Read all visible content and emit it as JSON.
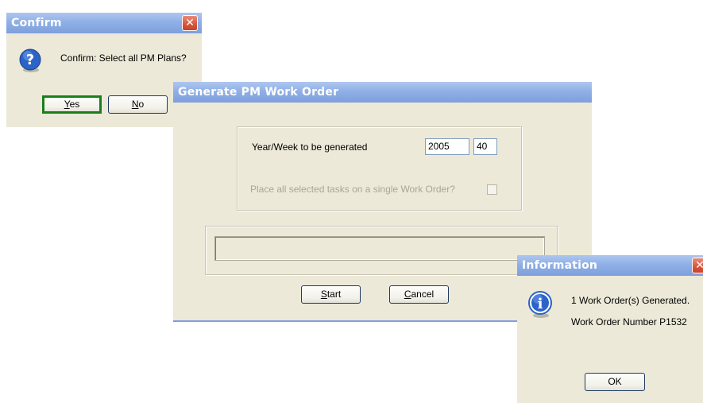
{
  "confirm_dialog": {
    "title": "Confirm",
    "close_glyph": "✕",
    "message": "Confirm: Select all PM Plans?",
    "icon": "question-icon",
    "yes_mnemonic": "Y",
    "yes_rest": "es",
    "no_mnemonic": "N",
    "no_rest": "o"
  },
  "generate_dialog": {
    "title": "Generate PM Work Order",
    "year_week_label": "Year/Week to be generated",
    "year_value": "2005",
    "week_value": "40",
    "single_wo_label": "Place all selected tasks on a single Work Order?",
    "single_wo_checked": false,
    "start_mnemonic": "S",
    "start_rest": "tart",
    "cancel_mnemonic": "C",
    "cancel_rest": "ancel"
  },
  "info_dialog": {
    "title": "Information",
    "close_glyph": "✕",
    "icon": "info-icon",
    "line1": "1 Work Order(s) Generated.",
    "line2": "Work Order Number P1532",
    "ok_label": "OK"
  },
  "colors": {
    "dialog_bg": "#ece9d8",
    "title_gradient_top": "#aec6ef",
    "title_gradient_bottom": "#7e9fdc",
    "close_red": "#d7543b",
    "default_button_border": "#1a7f1a"
  }
}
